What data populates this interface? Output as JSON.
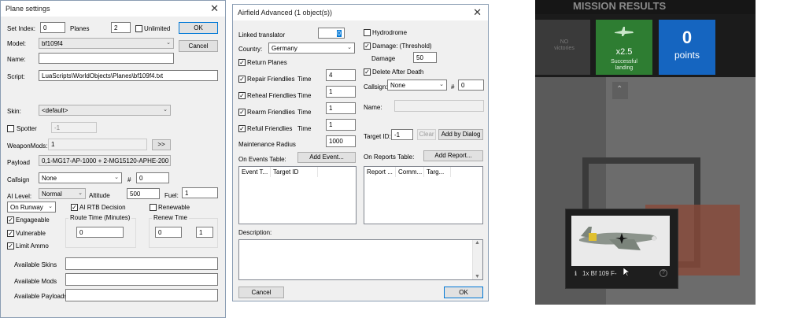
{
  "plane": {
    "title": "Plane settings",
    "set_index_label": "Set Index:",
    "set_index_value": "0",
    "planes_label": "Planes",
    "planes_value": "2",
    "unlimited_label": "Unlimited",
    "ok_label": "OK",
    "cancel_label": "Cancel",
    "model_label": "Model:",
    "model_value": "bf109f4",
    "name_label": "Name:",
    "name_value": "",
    "script_label": "Script:",
    "script_value": "LuaScripts\\WorldObjects\\Planes\\bf109f4.txt",
    "skin_label": "Skin:",
    "skin_value": "<default>",
    "spotter_label": "Spotter",
    "spotter_value": "-1",
    "weaponmods_label": "WeaponMods:",
    "weaponmods_value": "1",
    "more_label": ">>",
    "payload_label": "Payload",
    "payload_value": "0,1-MG17-AP-1000 + 2-MG15120-APHE-200",
    "callsign_label": "Callsign",
    "callsign_value": "None",
    "hash_label": "#",
    "callsign_num": "0",
    "ai_level_label": "AI Level:",
    "ai_level_value": "Normal",
    "altitude_label": "Altitude",
    "altitude_value": "500",
    "fuel_label": "Fuel:",
    "fuel_value": "1",
    "start_value": "On Runway",
    "ai_rtb_label": "AI RTB Decision",
    "renewable_label": "Renewable",
    "engageable_label": "Engageable",
    "vulnerable_label": "Vulnerable",
    "limit_ammo_label": "Limit Ammo",
    "route_time_label": "Route Time (Minutes)",
    "route_time_value": "0",
    "renew_time_label": "Renew Tme",
    "renew_time_a": "0",
    "renew_time_b": "1",
    "available_skins_label": "Available Skins",
    "available_mods_label": "Available Mods",
    "available_payloads_label": "Available Payloads",
    "check_mark": "✓"
  },
  "airfield": {
    "title": "Airfield Advanced (1 object(s))",
    "linked_label": "Linked translator",
    "linked_value": "0",
    "country_label": "Country:",
    "country_value": "Germany",
    "return_planes_label": "Return Planes",
    "repair_label": "Repair Friendlies",
    "reheal_label": "Reheal Friendlies",
    "rearm_label": "Rearm Friendlies",
    "refuil_label": "Refuil Friendlies",
    "time_label": "Time",
    "repair_time": "4",
    "reheal_time": "1",
    "rearm_time": "1",
    "refuil_time": "1",
    "maint_label": "Maintenance Radius",
    "maint_value": "1000",
    "events_label": "On Events Table:",
    "add_event_label": "Add Event...",
    "events_cols": [
      "Event T...",
      "Target ID"
    ],
    "hydrodrome_label": "Hydrodrome",
    "damage_threshold_label": "Damage: (Threshold)",
    "damage_label": "Damage",
    "damage_value": "50",
    "delete_after_label": "Delete After Death",
    "callsign_label": "Callsign:",
    "callsign_value": "None",
    "hash_label": "#",
    "callsign_num": "0",
    "name_label": "Name:",
    "target_id_label": "Target ID:",
    "target_id_value": "-1",
    "clear_label": "Clear",
    "add_dialog_label": "Add by Dialog",
    "reports_label": "On Reports Table:",
    "add_report_label": "Add Report...",
    "reports_cols": [
      "Report ...",
      "Comm...",
      "Targ..."
    ],
    "description_label": "Description:",
    "cancel_label": "Cancel",
    "ok_label": "OK"
  },
  "game": {
    "header": "MISSION RESULTS",
    "no_victories": "NO\nvictories",
    "multiplier": "x2.5",
    "successful_landing": "Successful\nlanding",
    "points_value": "0",
    "points_label": "points",
    "plane_caption": "1x Bf 109 F-",
    "info_icon_glyph": "ℹ",
    "help_icon_glyph": "?"
  },
  "colors": {
    "green_tile": "#2e7d32",
    "blue_tile": "#1565c0",
    "game_bg": "#1b1b1b",
    "dialog_bg": "#f0f0f0"
  }
}
